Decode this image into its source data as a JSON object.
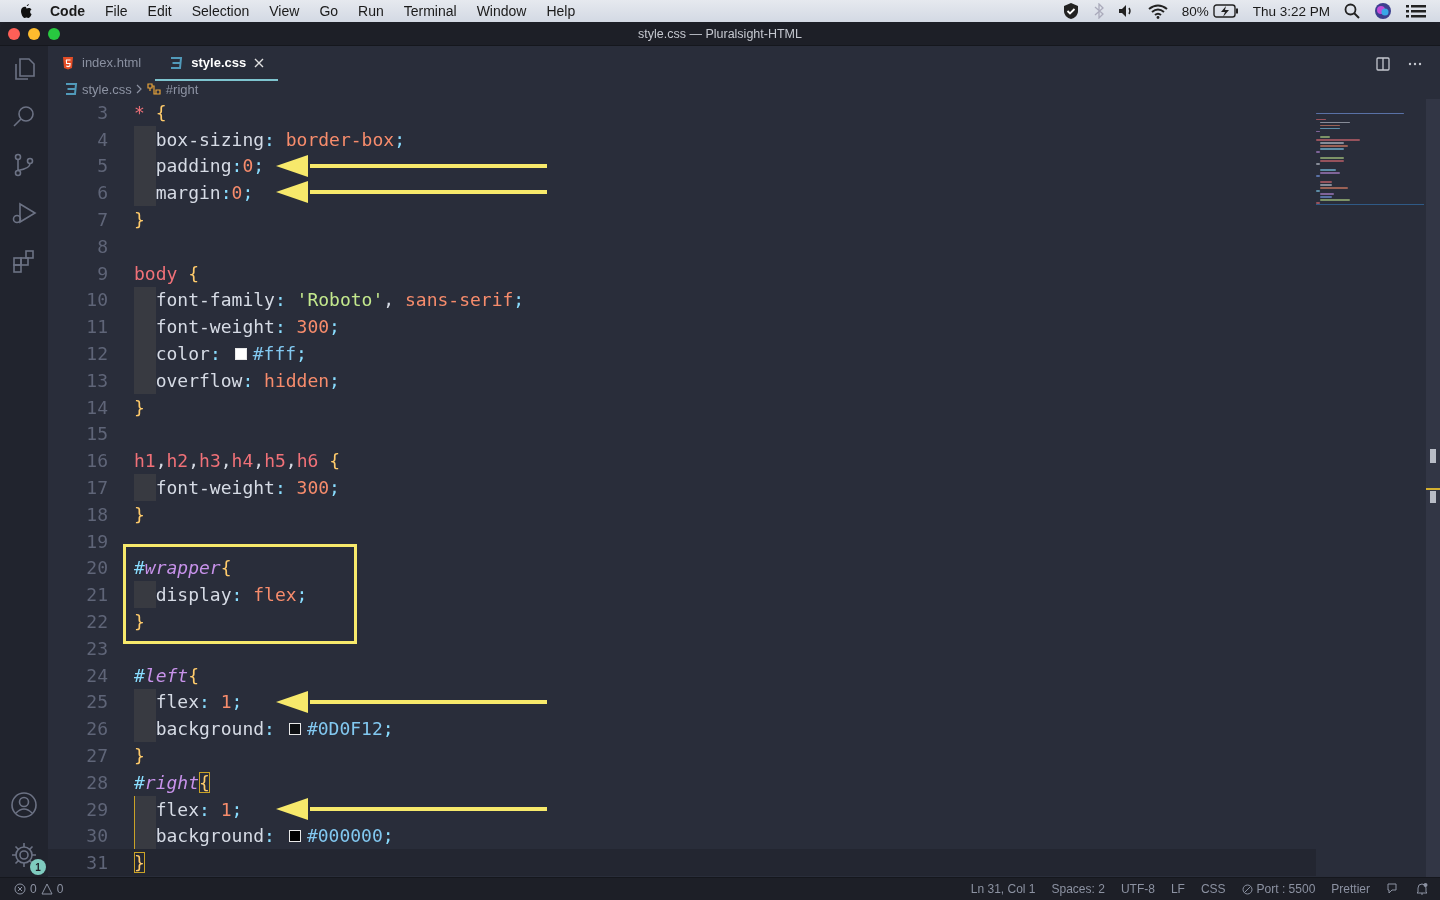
{
  "menubar": {
    "items": [
      {
        "label": "Code",
        "bold": true
      },
      {
        "label": "File",
        "bold": false
      },
      {
        "label": "Edit",
        "bold": false
      },
      {
        "label": "Selection",
        "bold": false
      },
      {
        "label": "View",
        "bold": false
      },
      {
        "label": "Go",
        "bold": false
      },
      {
        "label": "Run",
        "bold": false
      },
      {
        "label": "Terminal",
        "bold": false
      },
      {
        "label": "Window",
        "bold": false
      },
      {
        "label": "Help",
        "bold": false
      }
    ],
    "battery": "80%",
    "clock": "Thu 3:22 PM"
  },
  "window": {
    "title": "style.css — Pluralsight-HTML"
  },
  "activity_bar": {
    "settings_badge": "1"
  },
  "tabs": [
    {
      "label": "index.html",
      "kind": "html",
      "selected": false
    },
    {
      "label": "style.css",
      "kind": "css",
      "selected": true
    }
  ],
  "breadcrumb": {
    "file": "style.css",
    "symbol": "#right"
  },
  "lines": [
    {
      "number": "3",
      "tokens": [
        {
          "kind": "sel",
          "t": "*"
        },
        {
          "kind": "brace",
          "t": " {"
        }
      ]
    },
    {
      "number": "4",
      "indented": true,
      "tokens": [
        {
          "kind": "prop",
          "t": "box-sizing"
        },
        {
          "kind": "punc",
          "t": ":"
        },
        {
          "kind": "val",
          "t": " border-box"
        },
        {
          "kind": "punc",
          "t": ";"
        }
      ]
    },
    {
      "number": "5",
      "indented": true,
      "arrow": true,
      "tokens": [
        {
          "kind": "prop",
          "t": "padding"
        },
        {
          "kind": "punc",
          "t": ":"
        },
        {
          "kind": "val",
          "t": "0"
        },
        {
          "kind": "punc",
          "t": ";"
        }
      ]
    },
    {
      "number": "6",
      "indented": true,
      "arrow": true,
      "tokens": [
        {
          "kind": "prop",
          "t": "margin"
        },
        {
          "kind": "punc",
          "t": ":"
        },
        {
          "kind": "val",
          "t": "0"
        },
        {
          "kind": "punc",
          "t": ";"
        }
      ]
    },
    {
      "number": "7",
      "tokens": [
        {
          "kind": "brace",
          "t": "}"
        }
      ]
    },
    {
      "number": "8"
    },
    {
      "number": "9",
      "tokens": [
        {
          "kind": "sel",
          "t": "body"
        },
        {
          "kind": "brace",
          "t": " {"
        }
      ]
    },
    {
      "number": "10",
      "indented": true,
      "tokens": [
        {
          "kind": "prop",
          "t": "font-family"
        },
        {
          "kind": "punc",
          "t": ":"
        },
        {
          "kind": "str",
          "t": " 'Roboto'"
        },
        {
          "kind": "plain",
          "t": ","
        },
        {
          "kind": "val",
          "t": " sans-serif"
        },
        {
          "kind": "punc",
          "t": ";"
        }
      ]
    },
    {
      "number": "11",
      "indented": true,
      "tokens": [
        {
          "kind": "prop",
          "t": "font-weight"
        },
        {
          "kind": "punc",
          "t": ":"
        },
        {
          "kind": "val",
          "t": " 300"
        },
        {
          "kind": "punc",
          "t": ";"
        }
      ]
    },
    {
      "number": "12",
      "indented": true,
      "tokens": [
        {
          "kind": "prop",
          "t": "color"
        },
        {
          "kind": "punc",
          "t": ":"
        },
        {
          "kind": "swatch",
          "color": "#ffffff"
        },
        {
          "kind": "hex",
          "t": "#fff"
        },
        {
          "kind": "punc",
          "t": ";"
        }
      ]
    },
    {
      "number": "13",
      "indented": true,
      "tokens": [
        {
          "kind": "prop",
          "t": "overflow"
        },
        {
          "kind": "punc",
          "t": ":"
        },
        {
          "kind": "val",
          "t": " hidden"
        },
        {
          "kind": "punc",
          "t": ";"
        }
      ]
    },
    {
      "number": "14",
      "tokens": [
        {
          "kind": "brace",
          "t": "}"
        }
      ]
    },
    {
      "number": "15"
    },
    {
      "number": "16",
      "tokens": [
        {
          "kind": "sel",
          "t": "h1"
        },
        {
          "kind": "plain",
          "t": ","
        },
        {
          "kind": "sel",
          "t": "h2"
        },
        {
          "kind": "plain",
          "t": ","
        },
        {
          "kind": "sel",
          "t": "h3"
        },
        {
          "kind": "plain",
          "t": ","
        },
        {
          "kind": "sel",
          "t": "h4"
        },
        {
          "kind": "plain",
          "t": ","
        },
        {
          "kind": "sel",
          "t": "h5"
        },
        {
          "kind": "plain",
          "t": ","
        },
        {
          "kind": "sel",
          "t": "h6"
        },
        {
          "kind": "brace",
          "t": " {"
        }
      ]
    },
    {
      "number": "17",
      "indented": true,
      "tokens": [
        {
          "kind": "prop",
          "t": "font-weight"
        },
        {
          "kind": "punc",
          "t": ":"
        },
        {
          "kind": "val",
          "t": " 300"
        },
        {
          "kind": "punc",
          "t": ";"
        }
      ]
    },
    {
      "number": "18",
      "tokens": [
        {
          "kind": "brace",
          "t": "}"
        }
      ]
    },
    {
      "number": "19"
    },
    {
      "number": "20",
      "boxed": true,
      "tokens": [
        {
          "kind": "hash",
          "t": "#"
        },
        {
          "kind": "id",
          "t": "wrapper"
        },
        {
          "kind": "brace",
          "t": "{"
        }
      ]
    },
    {
      "number": "21",
      "boxed": true,
      "indented": true,
      "tokens": [
        {
          "kind": "prop",
          "t": "display"
        },
        {
          "kind": "punc",
          "t": ":"
        },
        {
          "kind": "val",
          "t": " flex"
        },
        {
          "kind": "punc",
          "t": ";"
        }
      ]
    },
    {
      "number": "22",
      "boxed": true,
      "tokens": [
        {
          "kind": "brace",
          "t": "}"
        }
      ]
    },
    {
      "number": "23"
    },
    {
      "number": "24",
      "tokens": [
        {
          "kind": "hash",
          "t": "#"
        },
        {
          "kind": "id",
          "t": "left"
        },
        {
          "kind": "brace",
          "t": "{"
        }
      ]
    },
    {
      "number": "25",
      "indented": true,
      "arrow": true,
      "tokens": [
        {
          "kind": "prop",
          "t": "flex"
        },
        {
          "kind": "punc",
          "t": ":"
        },
        {
          "kind": "val",
          "t": " 1"
        },
        {
          "kind": "punc",
          "t": ";"
        }
      ]
    },
    {
      "number": "26",
      "indented": true,
      "tokens": [
        {
          "kind": "prop",
          "t": "background"
        },
        {
          "kind": "punc",
          "t": ":"
        },
        {
          "kind": "swatch",
          "color": "#0d0f12"
        },
        {
          "kind": "hex",
          "t": "#0D0F12"
        },
        {
          "kind": "punc",
          "t": ";"
        }
      ]
    },
    {
      "number": "27",
      "tokens": [
        {
          "kind": "brace",
          "t": "}"
        }
      ]
    },
    {
      "number": "28",
      "tokens": [
        {
          "kind": "hash",
          "t": "#"
        },
        {
          "kind": "id",
          "t": "right"
        },
        {
          "kind": "brace",
          "t": "{",
          "matched": true
        }
      ]
    },
    {
      "number": "29",
      "indented": true,
      "active_guide": true,
      "arrow": true,
      "tokens": [
        {
          "kind": "prop",
          "t": "flex"
        },
        {
          "kind": "punc",
          "t": ":"
        },
        {
          "kind": "val",
          "t": " 1"
        },
        {
          "kind": "punc",
          "t": ";"
        }
      ]
    },
    {
      "number": "30",
      "indented": true,
      "active_guide": true,
      "tokens": [
        {
          "kind": "prop",
          "t": "background"
        },
        {
          "kind": "punc",
          "t": ":"
        },
        {
          "kind": "swatch",
          "color": "#000000"
        },
        {
          "kind": "hex",
          "t": "#000000"
        },
        {
          "kind": "punc",
          "t": ";"
        }
      ]
    },
    {
      "number": "31",
      "current": true,
      "tokens": [
        {
          "kind": "brace",
          "t": "}",
          "matched": true
        }
      ]
    }
  ],
  "status_bar": {
    "errors": "0",
    "warnings": "0",
    "items": [
      "Ln 31, Col 1",
      "Spaces: 2",
      "UTF-8",
      "LF",
      "CSS",
      "Port : 5500",
      "Prettier"
    ]
  }
}
